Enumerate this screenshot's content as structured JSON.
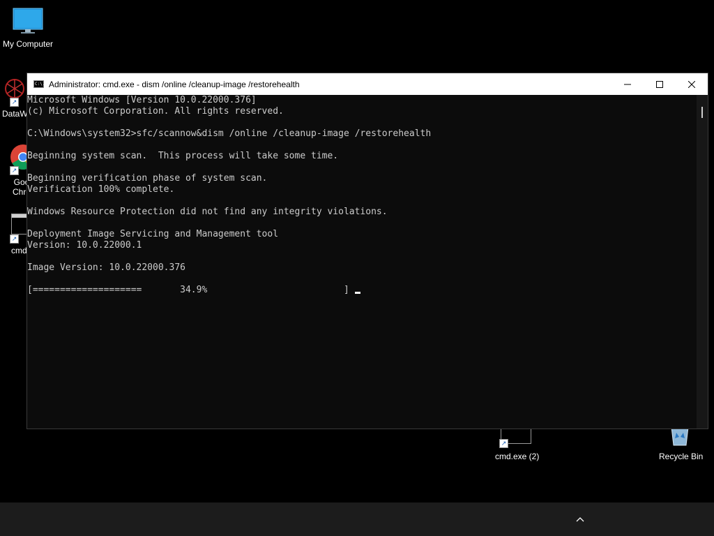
{
  "desktop": {
    "icons": [
      {
        "label": "My Computer"
      },
      {
        "label": "DataW"
      },
      {
        "label": "Goo\nChro"
      },
      {
        "label": "cmd"
      },
      {
        "label": "cmd.exe (2)"
      },
      {
        "label": "Recycle Bin"
      }
    ]
  },
  "window": {
    "title": "Administrator: cmd.exe - dism  /online /cleanup-image /restorehealth",
    "icon_text": "C:\\.",
    "controls": {
      "minimize": "—",
      "maximize": "☐",
      "close": "✕"
    },
    "lines": [
      "Microsoft Windows [Version 10.0.22000.376]",
      "(c) Microsoft Corporation. All rights reserved.",
      "",
      "C:\\Windows\\system32>sfc/scannow&dism /online /cleanup-image /restorehealth",
      "",
      "Beginning system scan.  This process will take some time.",
      "",
      "Beginning verification phase of system scan.",
      "Verification 100% complete.",
      "",
      "Windows Resource Protection did not find any integrity violations.",
      "",
      "Deployment Image Servicing and Management tool",
      "Version: 10.0.22000.1",
      "",
      "Image Version: 10.0.22000.376",
      ""
    ],
    "progress_line": "[====================       34.9%                         ]"
  },
  "taskbar": {
    "tray_chevron": "^"
  },
  "colors": {
    "desktop_bg": "#000000",
    "console_bg": "#0c0c0c",
    "console_text": "#cccccc",
    "titlebar_bg": "#ffffff",
    "taskbar_bg": "#1c1c1c"
  }
}
